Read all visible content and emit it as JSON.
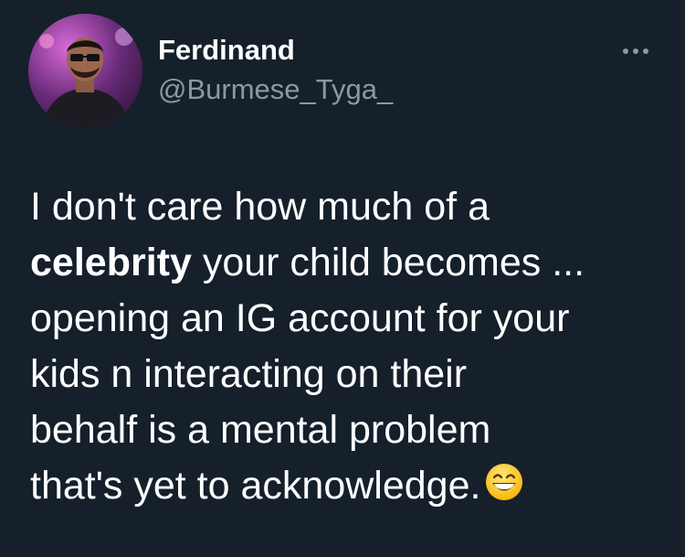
{
  "author": {
    "display_name": "Ferdinand",
    "handle": "@Burmese_Tyga_",
    "avatar_icon": "profile-photo"
  },
  "more_icon": "ellipsis-horizontal-icon",
  "tweet": {
    "line1": "I don't care how much of a",
    "line2_bold": "celebrity",
    "line2_rest": " your child becomes ...",
    "line3": "opening an IG account for your",
    "line4": "kids n interacting on their",
    "line5": "behalf is a mental problem",
    "line6": "that's yet to acknowledge.",
    "emoji_icon": "grinning-face-with-smiling-eyes-emoji"
  },
  "colors": {
    "background": "#15202b",
    "text_primary": "#ffffff",
    "text_secondary": "#8b98a5"
  }
}
